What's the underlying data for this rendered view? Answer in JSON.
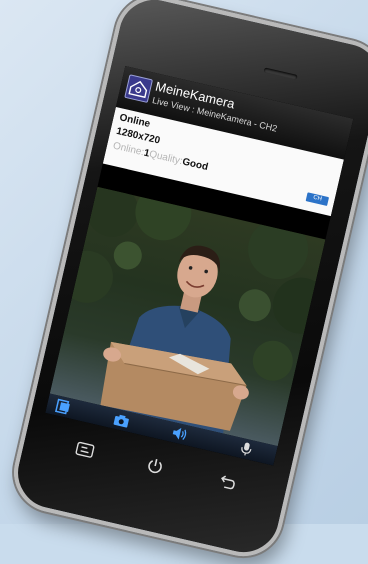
{
  "app": {
    "title": "MeineKamera",
    "subtitle": "Live View : MeineKamera - CH2"
  },
  "status": {
    "connection": "Online",
    "resolution": "1280x720",
    "online_label": "Online:",
    "online_count": "1",
    "quality_label": "Quality:",
    "quality_value": "Good",
    "channel_badge": "CH"
  },
  "toolbar": {
    "icons": [
      "gallery-icon",
      "camera-icon",
      "speaker-icon",
      "microphone-icon"
    ]
  },
  "phone_nav": {
    "icons": [
      "menu-icon",
      "power-icon",
      "back-icon"
    ]
  },
  "colors": {
    "accent": "#4aa1ff",
    "titlebar": "#1a1a1a",
    "info_bg": "#fafafa",
    "badge": "#2c73c8"
  }
}
